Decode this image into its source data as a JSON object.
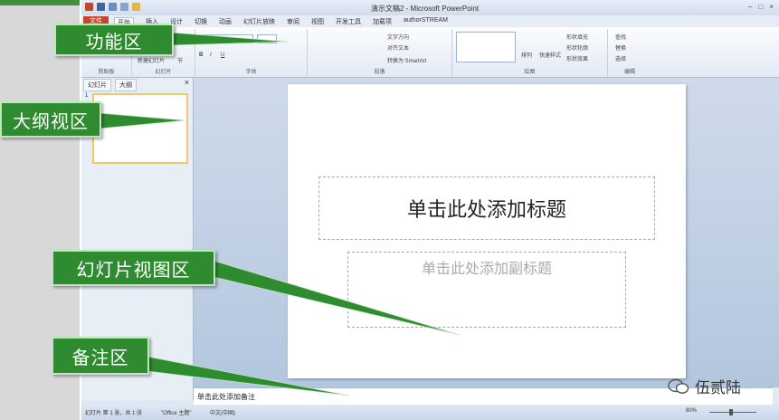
{
  "window": {
    "title": "演示文稿2 - Microsoft PowerPoint",
    "controls": [
      "–",
      "□",
      "×"
    ]
  },
  "menu": {
    "file": "文件",
    "tabs": [
      "开始",
      "插入",
      "设计",
      "切换",
      "动画",
      "幻灯片放映",
      "审阅",
      "视图",
      "开发工具",
      "加载项",
      "authorSTREAM"
    ]
  },
  "ribbon": {
    "groups": [
      {
        "label": "剪贴板"
      },
      {
        "label": "幻灯片"
      },
      {
        "label": "字体"
      },
      {
        "label": "段落"
      },
      {
        "label": "绘图"
      },
      {
        "label": "编辑"
      }
    ],
    "items": {
      "new_slide": "新建幻灯片",
      "section": "节",
      "text_dir": "文字方向",
      "align_text": "对齐文本",
      "smartart": "转换为 SmartArt",
      "arrange": "排列",
      "quick_styles": "快速样式",
      "shape_fill": "形状填充",
      "shape_outline": "形状轮廓",
      "shape_effects": "形状效果",
      "find": "查找",
      "replace": "替换",
      "select": "选择"
    }
  },
  "pane": {
    "tabs": [
      "幻灯片",
      "大纲"
    ],
    "close": "×",
    "thumb_number": "1"
  },
  "slide": {
    "title_placeholder": "单击此处添加标题",
    "subtitle_placeholder": "单击此处添加副标题"
  },
  "notes": {
    "placeholder": "单击此处添加备注"
  },
  "status": {
    "slide_info": "幻灯片 第 1 张，共 1 张",
    "theme": "\"Office 主题\"",
    "language": "中文(中国)",
    "zoom": "80%"
  },
  "callouts": {
    "ribbon": "功能区",
    "outline": "大纲视区",
    "slide_view": "幻灯片视图区",
    "notes": "备注区"
  },
  "watermark": {
    "text": "伍贰陆"
  },
  "colors": {
    "callout_bg": "#2f8b2f",
    "file_tab": "#c6462c",
    "window_bg": "#dfe7f1"
  }
}
